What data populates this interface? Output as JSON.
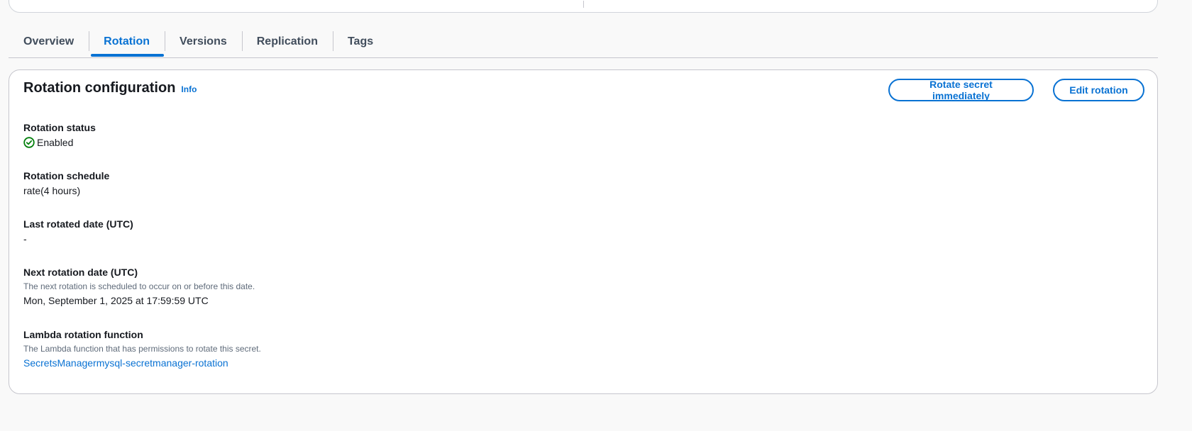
{
  "tabs": [
    {
      "label": "Overview"
    },
    {
      "label": "Rotation"
    },
    {
      "label": "Versions"
    },
    {
      "label": "Replication"
    },
    {
      "label": "Tags"
    }
  ],
  "panel": {
    "title": "Rotation configuration",
    "info_label": "Info",
    "rotate_button": "Rotate secret immediately",
    "edit_button": "Edit rotation"
  },
  "fields": {
    "status": {
      "label": "Rotation status",
      "value": "Enabled",
      "icon": "check-circle-icon",
      "color": "#037f0c"
    },
    "schedule": {
      "label": "Rotation schedule",
      "value": "rate(4 hours)"
    },
    "last_rotated": {
      "label": "Last rotated date (UTC)",
      "value": "-"
    },
    "next_rotation": {
      "label": "Next rotation date (UTC)",
      "description": "The next rotation is scheduled to occur on or before this date.",
      "value": "Mon, September 1, 2025 at 17:59:59 UTC"
    },
    "lambda": {
      "label": "Lambda rotation function",
      "description": "The Lambda function that has permissions to rotate this secret.",
      "value": "SecretsManagermysql-secretmanager-rotation"
    }
  },
  "colors": {
    "accent": "#0972d3",
    "success": "#037f0c",
    "text": "#16191f",
    "muted": "#5f6b7a"
  }
}
